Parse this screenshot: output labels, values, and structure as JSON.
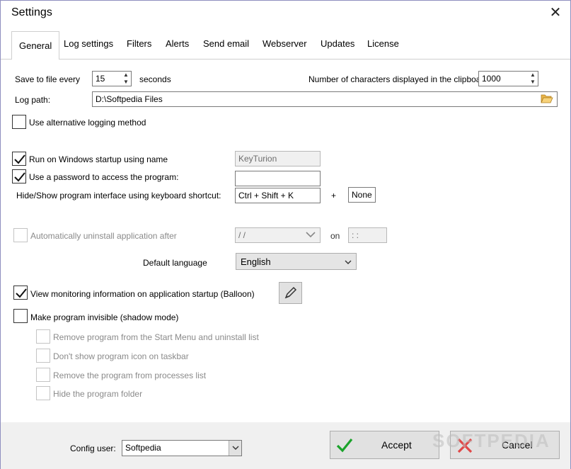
{
  "window": {
    "title": "Settings"
  },
  "tabs": [
    "General",
    "Log settings",
    "Filters",
    "Alerts",
    "Send email",
    "Webserver",
    "Updates",
    "License"
  ],
  "general": {
    "save_label": "Save to file every",
    "save_value": "15",
    "save_unit": "seconds",
    "clip_label": "Number of characters displayed in the clipboard",
    "clip_value": "1000",
    "logpath_label": "Log path:",
    "logpath_value": "D:\\Softpedia Files",
    "alt_logging": "Use alternative logging method",
    "run_startup": "Run on Windows startup using name",
    "startup_name": "KeyTurion",
    "use_password": "Use a password to access the program:",
    "password_value": "",
    "shortcut_label": "Hide/Show program interface using keyboard shortcut:",
    "shortcut_value": "Ctrl + Shift + K",
    "plus": "+",
    "shortcut_extra": "None",
    "auto_uninstall": "Automatically uninstall application after",
    "date_value": " /  /",
    "on_label": "on",
    "time_value": " :  :",
    "language_label": "Default language",
    "language_value": "English",
    "view_monitoring": "View monitoring information on application startup (Balloon)",
    "invisible": "Make program invisible (shadow mode)",
    "remove_start": "Remove program from the Start Menu and uninstall list",
    "no_taskbar": "Don't show program icon on taskbar",
    "remove_processes": "Remove the program from processes list",
    "hide_folder": "Hide the program folder"
  },
  "footer": {
    "config_label": "Config user:",
    "config_value": "Softpedia",
    "accept": "Accept",
    "cancel": "Cancel"
  },
  "watermark": "SOFTPEDIA",
  "colors": {
    "check": "#1aa32a",
    "cancel_x": "#e04848"
  }
}
